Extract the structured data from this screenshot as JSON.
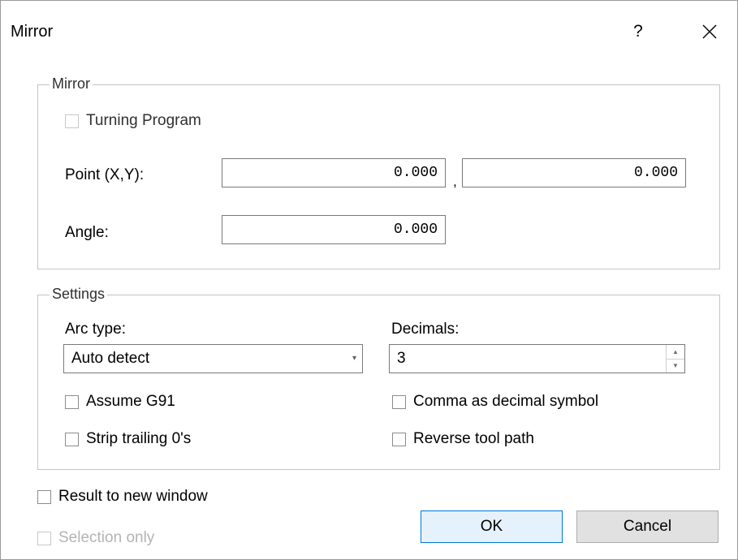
{
  "window": {
    "title": "Mirror",
    "help_label": "?"
  },
  "mirror_group": {
    "legend": "Mirror",
    "turning_program_label": "Turning Program",
    "point_label": "Point (X,Y):",
    "point_x": "0.000",
    "point_separator": ",",
    "point_y": "0.000",
    "angle_label": "Angle:",
    "angle_value": "0.000"
  },
  "settings_group": {
    "legend": "Settings",
    "arc_type_label": "Arc type:",
    "arc_type_value": "Auto detect",
    "decimals_label": "Decimals:",
    "decimals_value": "3",
    "assume_g91_label": "Assume G91",
    "strip_trailing_label": "Strip trailing 0's",
    "comma_decimal_label": "Comma as decimal symbol",
    "reverse_tool_path_label": "Reverse tool path"
  },
  "options": {
    "result_new_window_label": "Result to new window",
    "selection_only_label": "Selection only"
  },
  "buttons": {
    "ok_label": "OK",
    "cancel_label": "Cancel"
  },
  "icons": {
    "close": "close-icon",
    "dropdown": "chevron-down-icon",
    "spin_up": "chevron-up-icon",
    "spin_down": "chevron-down-icon"
  },
  "colors": {
    "default_button_border": "#0078d7",
    "default_button_bg": "#e5f1fb",
    "disabled_text": "#b4b4b4"
  }
}
